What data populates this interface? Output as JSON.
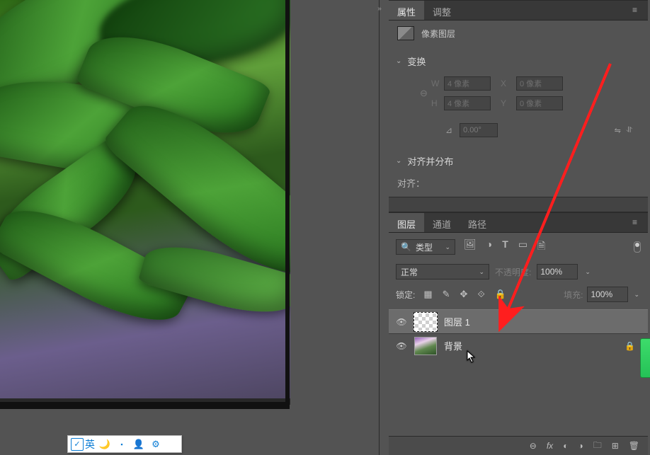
{
  "properties_panel": {
    "tabs": {
      "properties": "属性",
      "adjustments": "调整"
    },
    "layer_type_label": "像素图层",
    "transform": {
      "heading": "变换",
      "W_label": "W",
      "H_label": "H",
      "X_label": "X",
      "Y_label": "Y",
      "W_value": "4 像素",
      "H_value": "4 像素",
      "X_value": "0 像素",
      "Y_value": "0 像素",
      "angle_value": "0.00°"
    },
    "align": {
      "heading": "对齐并分布",
      "label": "对齐："
    }
  },
  "layers_panel": {
    "tabs": {
      "layers": "图层",
      "channels": "通道",
      "paths": "路径"
    },
    "filter_select": "类型",
    "blend_mode": "正常",
    "opacity_label": "不透明度:",
    "opacity_value": "100%",
    "lock_label": "锁定:",
    "fill_label": "填充:",
    "fill_value": "100%",
    "layers": [
      {
        "name": "图层 1",
        "selected": true,
        "visible": true,
        "locked": false,
        "thumb": "transparent"
      },
      {
        "name": "背景",
        "selected": false,
        "visible": true,
        "locked": true,
        "thumb": "photo"
      }
    ],
    "footer_icons": [
      "link",
      "fx",
      "mask",
      "adjust",
      "group",
      "new",
      "trash"
    ]
  },
  "ime_toolbar": {
    "lang_label": "英"
  },
  "icons": {
    "search": "🔍",
    "menu": "≡",
    "chev_down": "⌄",
    "chev_right": "›",
    "eye": "👁",
    "lock": "🔒",
    "image_type": "🖼",
    "ellipse": "◑",
    "text": "T",
    "rect": "▭",
    "smart": "🗎",
    "dot": "●",
    "angle": "⊿",
    "flip_h": "⇋",
    "flip_v": "⥯",
    "pixel_lock": "▦",
    "brush": "✎",
    "move": "✥",
    "artboard": "⟐",
    "full_lock": "🔒",
    "link": "⊖",
    "fx": "fx",
    "mask": "◐",
    "adjust": "◑",
    "group": "🗀",
    "new": "⊞",
    "trash": "🗑",
    "moon": "🌙",
    "mic": "▪",
    "person": "👤",
    "gear": "⚙",
    "ime_logo": "✓"
  }
}
